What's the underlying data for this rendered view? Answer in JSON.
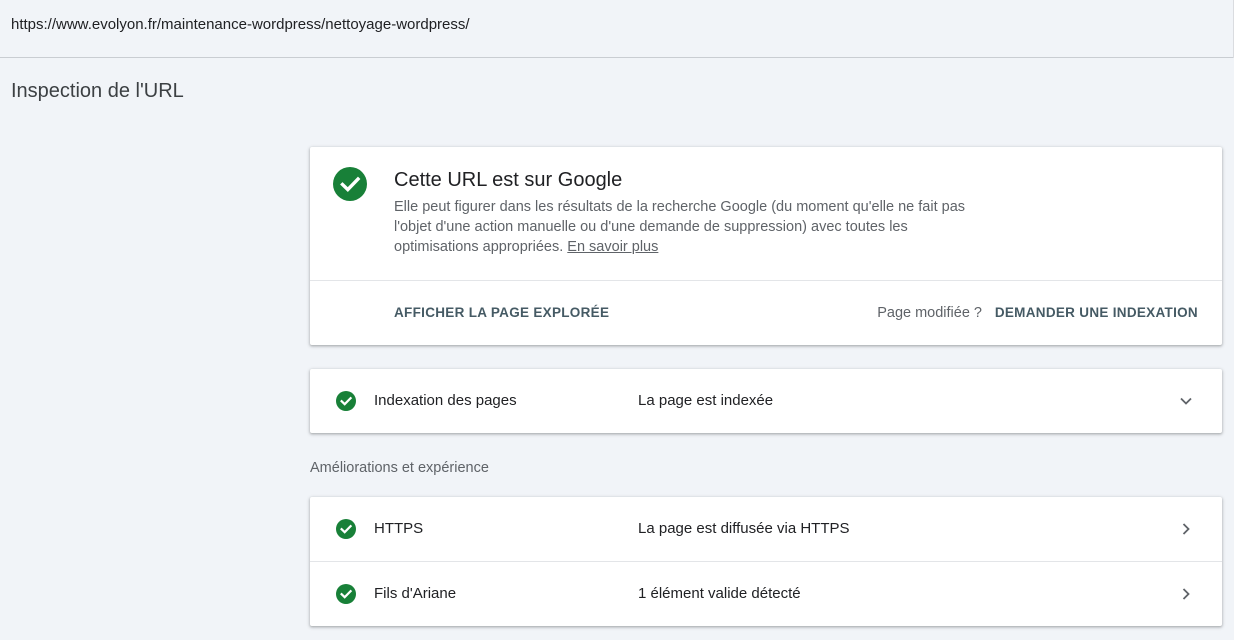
{
  "url_bar": {
    "url": "https://www.evolyon.fr/maintenance-wordpress/nettoyage-wordpress/"
  },
  "page_title": "Inspection de l'URL",
  "status_card": {
    "title": "Cette URL est sur Google",
    "description": "Elle peut figurer dans les résultats de la recherche Google (du moment qu'elle ne fait pas l'objet d'une action manuelle ou d'une demande de suppression) avec toutes les optimisations appropriées.",
    "learn_more": "En savoir plus",
    "view_crawled_label": "AFFICHER LA PAGE EXPLORÉE",
    "modified_label": "Page modifiée ?",
    "request_indexing_label": "DEMANDER UNE INDEXATION",
    "icon": "check-circle-icon",
    "accent_color": "#188038"
  },
  "indexing": {
    "label": "Indexation des pages",
    "value": "La page est indexée",
    "icon": "chevron-down-icon"
  },
  "enhancements": {
    "heading": "Améliorations et expérience",
    "rows": [
      {
        "label": "HTTPS",
        "value": "La page est diffusée via HTTPS",
        "icon": "chevron-right-icon"
      },
      {
        "label": "Fils d'Ariane",
        "value": "1 élément valide détecté",
        "icon": "chevron-right-icon"
      }
    ]
  }
}
